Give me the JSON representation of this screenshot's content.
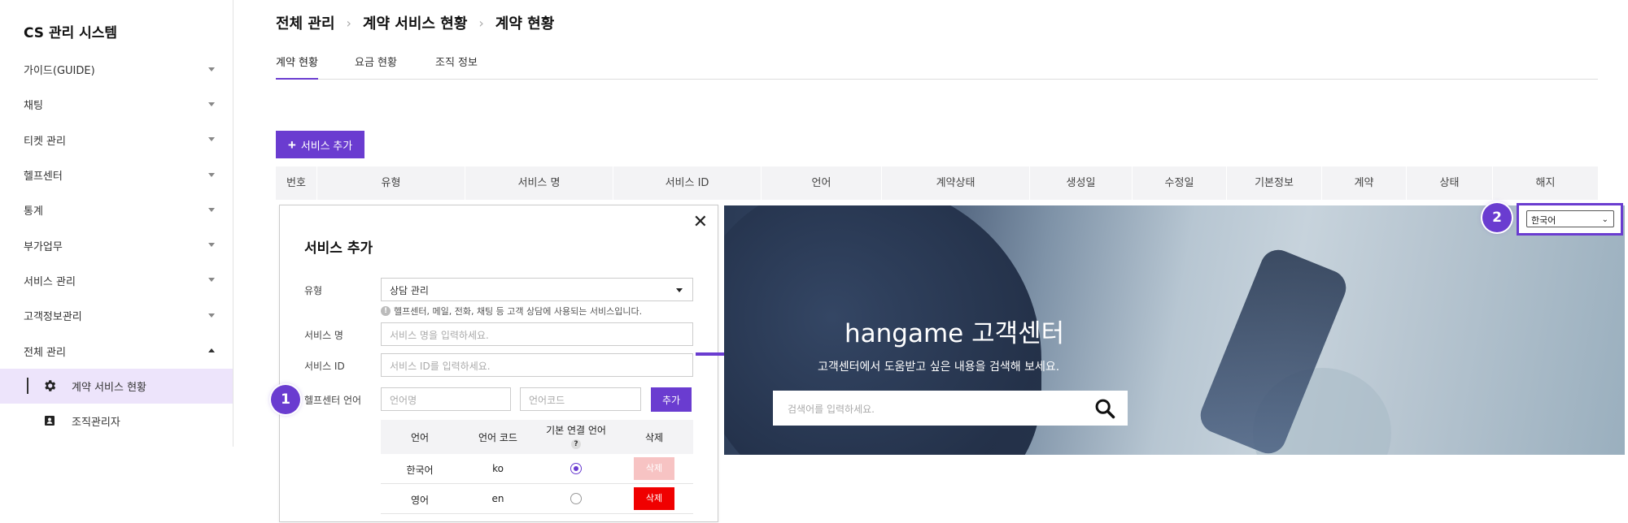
{
  "app": {
    "title": "CS 관리 시스템"
  },
  "sidebar": {
    "items": [
      {
        "label": "가이드(GUIDE)"
      },
      {
        "label": "채팅"
      },
      {
        "label": "티켓 관리"
      },
      {
        "label": "헬프센터"
      },
      {
        "label": "통계"
      },
      {
        "label": "부가업무"
      },
      {
        "label": "서비스 관리"
      },
      {
        "label": "고객정보관리"
      },
      {
        "label": "전체 관리"
      }
    ],
    "sub_items": [
      {
        "label": "계약 서비스 현황",
        "icon": "gear-icon",
        "active": true
      },
      {
        "label": "조직관리자",
        "icon": "id-card-icon",
        "active": false
      }
    ]
  },
  "breadcrumb": [
    "전체 관리",
    "계약 서비스 현황",
    "계약 현황"
  ],
  "tabs": [
    {
      "label": "계약 현황",
      "active": true
    },
    {
      "label": "요금 현황",
      "active": false
    },
    {
      "label": "조직 정보",
      "active": false
    }
  ],
  "add_button": {
    "label": "서비스 추가"
  },
  "table": {
    "headers": [
      "번호",
      "유형",
      "서비스 명",
      "서비스 ID",
      "언어",
      "계약상태",
      "생성일",
      "수정일",
      "기본정보",
      "계약",
      "상태",
      "해지"
    ]
  },
  "dialog": {
    "title": "서비스 추가",
    "type_label": "유형",
    "type_value": "상담 관리",
    "hint": "헬프센터, 메일, 전화, 채팅 등 고객 상담에 사용되는 서비스입니다.",
    "name_label": "서비스 명",
    "name_placeholder": "서비스 명을 입력하세요.",
    "id_label": "서비스 ID",
    "id_placeholder": "서비스 ID를 입력하세요.",
    "lang_label": "헬프센터 언어",
    "lang_name_placeholder": "언어명",
    "lang_code_placeholder": "언어코드",
    "add_label": "추가",
    "lang_table": {
      "headers": [
        "언어",
        "언어 코드",
        "기본 연결 언어",
        "삭제"
      ],
      "help_mark": "?",
      "rows": [
        {
          "lang": "한국어",
          "code": "ko",
          "default": true,
          "delete_label": "삭제",
          "delete_enabled": false
        },
        {
          "lang": "영어",
          "code": "en",
          "default": false,
          "delete_label": "삭제",
          "delete_enabled": true
        }
      ]
    }
  },
  "steps": {
    "one": "1",
    "two": "2"
  },
  "hero": {
    "title": "hangame 고객센터",
    "subtitle": "고객센터에서 도움받고 싶은 내용을 검색해 보세요.",
    "search_placeholder": "검색어를 입력하세요.",
    "language_selected": "한국어"
  },
  "colors": {
    "accent": "#6a3cd0",
    "danger": "#f00000",
    "danger_disabled": "#f7c3c3"
  }
}
